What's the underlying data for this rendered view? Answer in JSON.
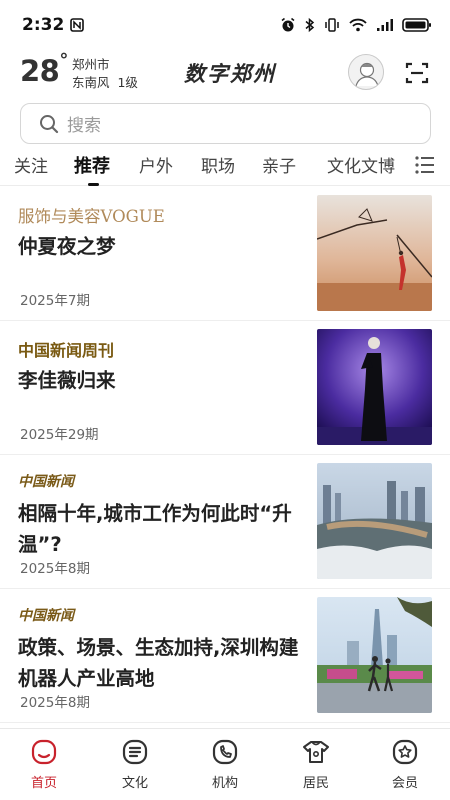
{
  "status_bar": {
    "time": "2:32"
  },
  "header": {
    "temperature": "28",
    "temperature_unit": "°",
    "city": "郑州市",
    "wind": "东南风  1级",
    "logo_text": "数字郑州"
  },
  "search": {
    "placeholder": "搜索"
  },
  "tabs": [
    "关注",
    "推荐",
    "户外",
    "职场",
    "亲子",
    "文化文博"
  ],
  "active_tab": "推荐",
  "articles": [
    {
      "source": "服饰与美容VOGUE",
      "title": "仲夏夜之梦",
      "issue": "2025年7期"
    },
    {
      "source": "中国新闻周刊",
      "title": "李佳薇归来",
      "issue": "2025年29期"
    },
    {
      "source": "中国新闻",
      "title": "相隔十年,城市工作为何此时“升温”?",
      "issue": "2025年8期"
    },
    {
      "source": "中国新闻",
      "title": "政策、场景、生态加持,深圳构建机器人产业高地",
      "issue": "2025年8期"
    }
  ],
  "bottom_nav": [
    {
      "label": "首页",
      "icon": "home-icon"
    },
    {
      "label": "文化",
      "icon": "culture-icon"
    },
    {
      "label": "机构",
      "icon": "institution-icon"
    },
    {
      "label": "居民",
      "icon": "resident-icon"
    },
    {
      "label": "会员",
      "icon": "member-icon"
    }
  ],
  "colors": {
    "accent": "#c8222c",
    "vogue_brand": "#b08a5a",
    "newsweek_brand": "#7a5a12",
    "china_news_brand": "#7a5a18"
  }
}
